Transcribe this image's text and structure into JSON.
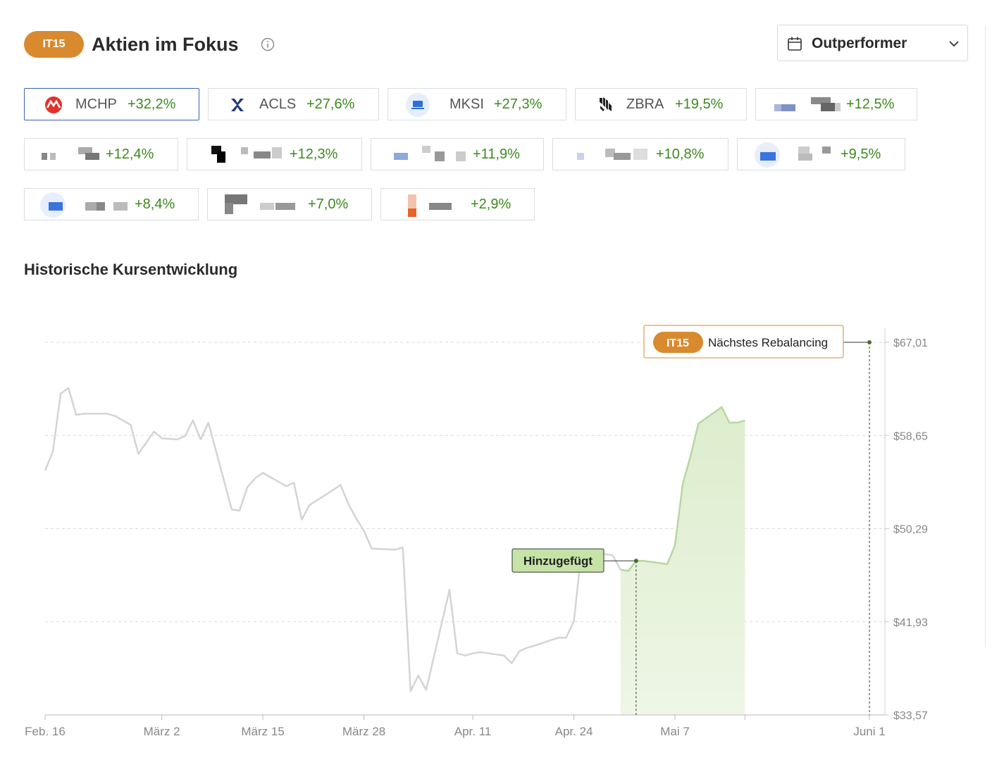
{
  "header": {
    "badge": "IT15",
    "title": "Aktien im Fokus",
    "info_icon": "info-circle-icon",
    "dropdown": {
      "icon": "calendar-icon",
      "label": "Outperformer",
      "chevron": "chevron-down-icon"
    }
  },
  "chips": [
    {
      "ticker": "MCHP",
      "change": "+32,2%",
      "logo": "microchip-logo",
      "active": true
    },
    {
      "ticker": "ACLS",
      "change": "+27,6%",
      "logo": "axcelis-logo"
    },
    {
      "ticker": "MKSI",
      "change": "+27,3%",
      "logo": "mks-logo"
    },
    {
      "ticker": "ZBRA",
      "change": "+19,5%",
      "logo": "zebra-logo"
    },
    {
      "ticker": "",
      "change": "+12,5%",
      "logo": "pixelated-logo"
    },
    {
      "ticker": "",
      "change": "+12,4%",
      "logo": "pixelated-logo"
    },
    {
      "ticker": "",
      "change": "+12,3%",
      "logo": "pixelated-logo"
    },
    {
      "ticker": "",
      "change": "+11,9%",
      "logo": "pixelated-logo"
    },
    {
      "ticker": "",
      "change": "+10,8%",
      "logo": "pixelated-logo"
    },
    {
      "ticker": "",
      "change": "+9,5%",
      "logo": "pixelated-logo"
    },
    {
      "ticker": "",
      "change": "+8,4%",
      "logo": "pixelated-logo"
    },
    {
      "ticker": "",
      "change": "+7,0%",
      "logo": "pixelated-logo"
    },
    {
      "ticker": "",
      "change": "+2,9%",
      "logo": "pixelated-logo"
    }
  ],
  "history": {
    "title": "Historische Kursentwicklung"
  },
  "chart_data": {
    "type": "line",
    "title": "",
    "xlabel": "",
    "ylabel": "",
    "x_ticks": [
      "Feb. 16",
      "März 2",
      "März 15",
      "März 28",
      "Apr. 11",
      "Apr. 24",
      "Mai 7",
      "Juni 1"
    ],
    "y_ticks": [
      "$67,01",
      "$58,65",
      "$50,29",
      "$41,93",
      "$33,57"
    ],
    "ylim": [
      33.57,
      67.01
    ],
    "xlim": [
      "2024-02-16",
      "2024-06-01"
    ],
    "grid": true,
    "colors": {
      "line": "#d4d4d4",
      "highlight_line": "#b7d7a0",
      "highlight_fill": "#dcedcc",
      "accent": "#d98a2e"
    },
    "annotations": [
      {
        "label": "Hinzugefügt",
        "date": "2024-05-02",
        "value": 47.4
      },
      {
        "badge": "IT15",
        "label": "Nächstes Rebalancing",
        "date": "2024-06-01",
        "value": 67.01
      }
    ],
    "series": [
      {
        "x": [
          "2024-02-16",
          "2024-02-17",
          "2024-02-18",
          "2024-02-19",
          "2024-02-20",
          "2024-02-21",
          "2024-02-24",
          "2024-02-25",
          "2024-02-26",
          "2024-02-27",
          "2024-02-28",
          "2024-03-01",
          "2024-03-02",
          "2024-03-04",
          "2024-03-05",
          "2024-03-06",
          "2024-03-07",
          "2024-03-08",
          "2024-03-11",
          "2024-03-12",
          "2024-03-13",
          "2024-03-14",
          "2024-03-15",
          "2024-03-18",
          "2024-03-19",
          "2024-03-20",
          "2024-03-21",
          "2024-03-25",
          "2024-03-26",
          "2024-03-27",
          "2024-03-28",
          "2024-03-29",
          "2024-04-01",
          "2024-04-02",
          "2024-04-03",
          "2024-04-04",
          "2024-04-05",
          "2024-04-08",
          "2024-04-09",
          "2024-04-10",
          "2024-04-11",
          "2024-04-12",
          "2024-04-15",
          "2024-04-16",
          "2024-04-17",
          "2024-04-18",
          "2024-04-19",
          "2024-04-22",
          "2024-04-23",
          "2024-04-24",
          "2024-04-25",
          "2024-04-26",
          "2024-04-29",
          "2024-04-30",
          "2024-05-01",
          "2024-05-02",
          "2024-05-03",
          "2024-05-06",
          "2024-05-07",
          "2024-05-08",
          "2024-05-09",
          "2024-05-10",
          "2024-05-13",
          "2024-05-14",
          "2024-05-15",
          "2024-05-16"
        ],
        "y": [
          55.5,
          57.2,
          62.4,
          62.9,
          60.5,
          60.6,
          60.6,
          60.4,
          60.0,
          59.6,
          57.0,
          59.0,
          58.4,
          58.3,
          58.6,
          60.0,
          58.3,
          59.8,
          52.0,
          51.9,
          54.0,
          54.8,
          55.3,
          54.1,
          54.4,
          51.1,
          52.4,
          54.2,
          52.5,
          51.2,
          50.1,
          48.5,
          48.4,
          48.6,
          35.7,
          37.1,
          35.8,
          44.8,
          39.1,
          38.9,
          39.1,
          39.2,
          38.9,
          38.2,
          39.3,
          39.6,
          39.8,
          40.5,
          40.5,
          42.0,
          48.4,
          48.2,
          47.9,
          46.6,
          46.5,
          47.4,
          47.4,
          47.1,
          48.8,
          54.3,
          56.8,
          59.7,
          61.2,
          59.8,
          59.8,
          60.0
        ]
      }
    ]
  }
}
